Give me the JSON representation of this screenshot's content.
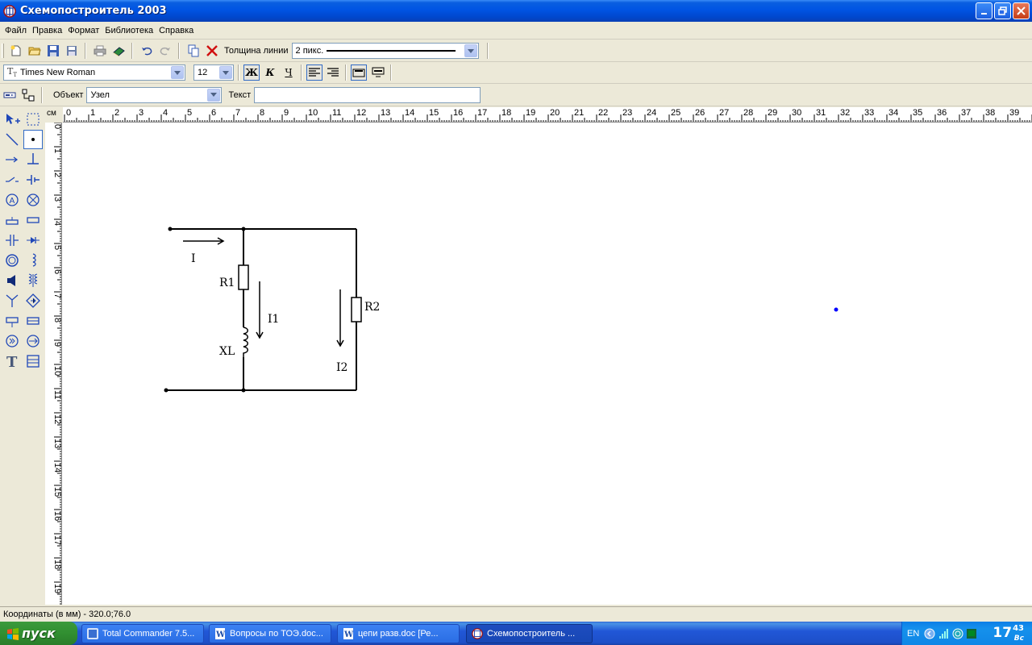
{
  "window": {
    "title": "Схемопостроитель 2003"
  },
  "menu": [
    "Файл",
    "Правка",
    "Формат",
    "Библиотека",
    "Справка"
  ],
  "toolbar1": {
    "line_width_label": "Толщина линии",
    "line_width_value": "2 пикс."
  },
  "toolbar2": {
    "font_name": "Times New Roman",
    "font_size": "12",
    "bold_label": "Ж",
    "italic_label": "К",
    "underline_label": "Ч"
  },
  "toolbar3": {
    "object_label": "Объект",
    "object_value": "Узел",
    "text_label": "Текст",
    "text_value": ""
  },
  "ruler": {
    "unit": "см",
    "h_ticks": [
      "0",
      "1",
      "2",
      "3",
      "4",
      "5",
      "6",
      "7",
      "8",
      "9",
      "10",
      "11",
      "12",
      "13",
      "14",
      "15",
      "16",
      "17",
      "18",
      "19",
      "20",
      "21",
      "22",
      "23",
      "24",
      "25",
      "26",
      "27",
      "28",
      "29",
      "30",
      "31",
      "32",
      "33",
      "34",
      "35",
      "36",
      "37",
      "38",
      "39"
    ],
    "v_ticks": [
      "0",
      "1",
      "2",
      "3",
      "4",
      "5",
      "6",
      "7",
      "8",
      "9",
      "10",
      "11",
      "12",
      "13",
      "14",
      "15",
      "16",
      "17",
      "18",
      "19"
    ]
  },
  "schematic": {
    "labels": {
      "current_main": "I",
      "r1": "R1",
      "i1": "I1",
      "xl": "XL",
      "r2": "R2",
      "i2": "I2"
    }
  },
  "status": {
    "coordinates": "Координаты (в мм) - 320.0;76.0"
  },
  "taskbar": {
    "start_label": "пуск",
    "tasks": [
      {
        "label": "Total Commander 7.5...",
        "active": false
      },
      {
        "label": "Вопросы по ТОЭ.doc...",
        "active": false
      },
      {
        "label": "цепи разв.doc [Ре...",
        "active": false
      },
      {
        "label": "Схемопостроитель ...",
        "active": true
      }
    ],
    "lang": "EN",
    "clock_hours": "17",
    "clock_minutes": "43",
    "clock_day": "Вс"
  },
  "colors": {
    "titlebar": "#0054e3",
    "taskbar": "#245edb",
    "start": "#318f31",
    "selection_dot": "#0000ff"
  }
}
